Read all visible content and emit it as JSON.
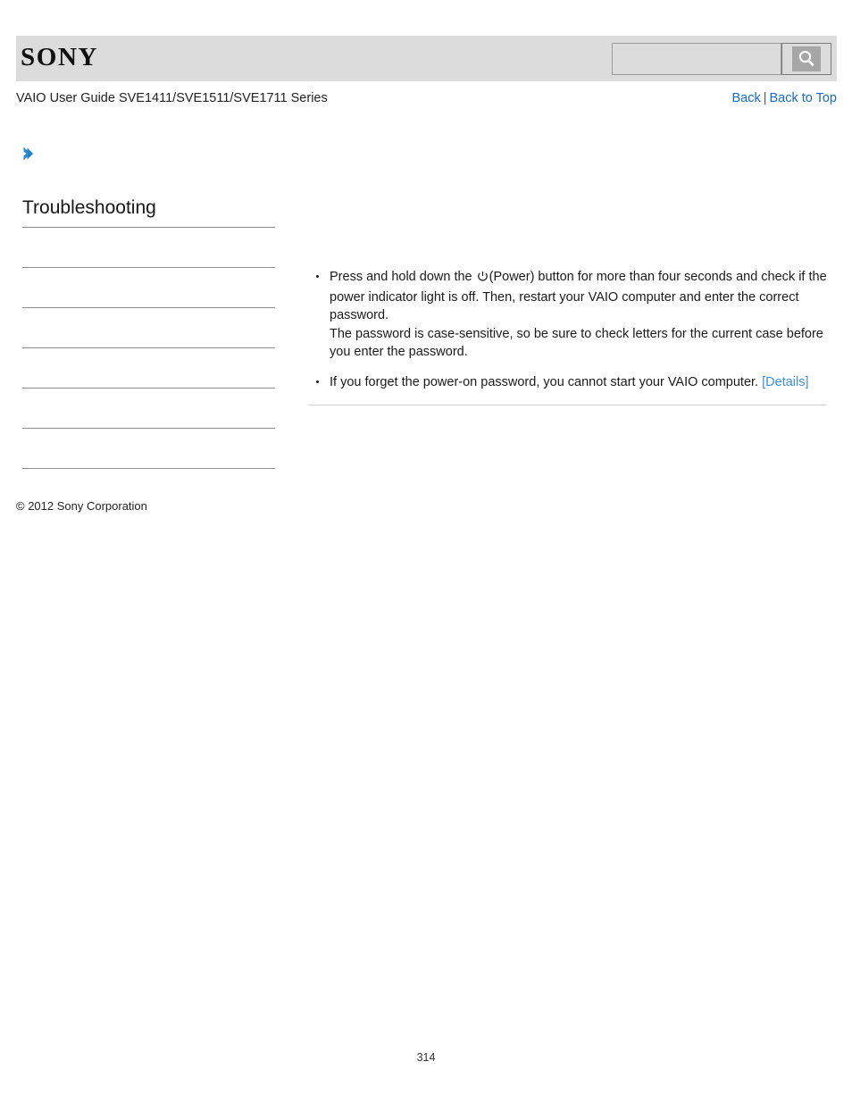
{
  "header": {
    "logo_text": "SONY",
    "search": {
      "value": "",
      "placeholder": "",
      "icon": "search-icon",
      "button_label": ""
    }
  },
  "title_bar": {
    "doc_title": "VAIO User Guide SVE1411/SVE1511/SVE1711 Series",
    "links": {
      "back": "Back",
      "separator": "|",
      "back_to_top": "Back to Top"
    }
  },
  "breadcrumb": {
    "icon": "chevron-right-icon",
    "text": ""
  },
  "sidebar": {
    "heading": "Troubleshooting",
    "items": [
      {
        "label": ""
      },
      {
        "label": ""
      },
      {
        "label": ""
      },
      {
        "label": ""
      },
      {
        "label": ""
      },
      {
        "label": ""
      }
    ]
  },
  "content": {
    "bullets": [
      {
        "text_before_icon": "Press and hold down the ",
        "icon": "power-icon",
        "text_after_icon": "(Power) button for more than four seconds and check if the power indicator light is off. Then, restart your VAIO computer and enter the correct password.",
        "extra_line": "The password is case-sensitive, so be sure to check letters for the current case before you enter the password."
      },
      {
        "text": "If you forget the power-on password, you cannot start your VAIO computer. ",
        "link_label": "[Details]"
      }
    ]
  },
  "footer": {
    "copyright": "© 2012 Sony Corporation",
    "page_number": "314"
  },
  "colors": {
    "header_band": "#dcdcdc",
    "link_blue": "#1769cf",
    "details_blue": "#3a8fe0",
    "chevron_blue": "#2b8fcf",
    "rule_gray": "#8d8d8d"
  }
}
